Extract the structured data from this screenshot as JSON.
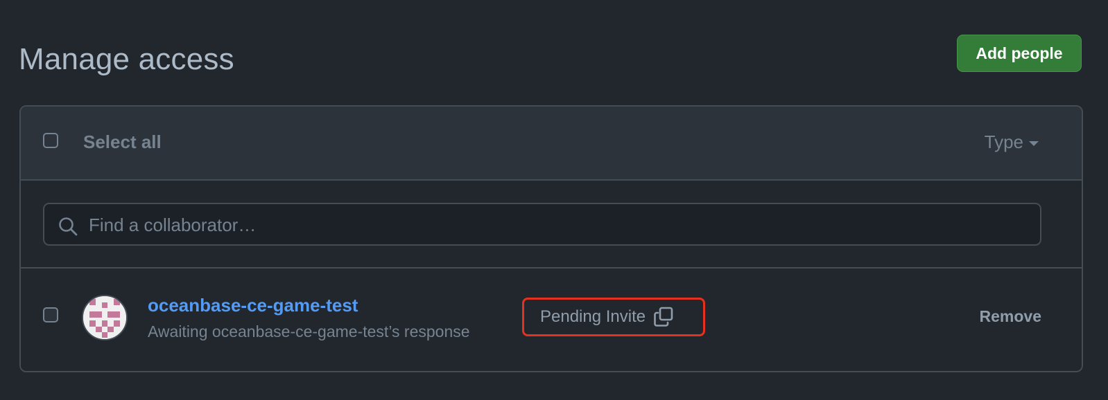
{
  "header": {
    "title": "Manage access",
    "add_button_label": "Add people"
  },
  "list_header": {
    "select_all_label": "Select all",
    "type_filter_label": "Type"
  },
  "search": {
    "placeholder": "Find a collaborator…",
    "value": ""
  },
  "collaborators": [
    {
      "username": "oceanbase-ce-game-test",
      "status_text": "Awaiting oceanbase-ce-game-test’s response",
      "badge_label": "Pending Invite",
      "remove_label": "Remove"
    }
  ],
  "colors": {
    "accent_green": "#347d39",
    "link_blue": "#539bf5",
    "highlight_red": "#e5321f",
    "avatar_pink": "#c2799a"
  }
}
